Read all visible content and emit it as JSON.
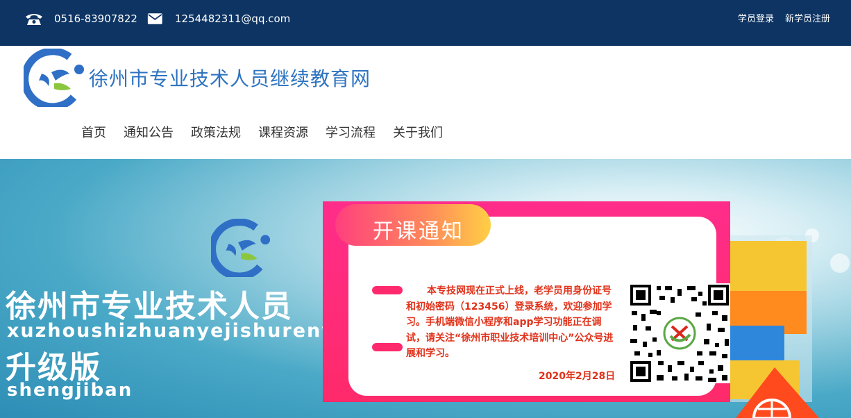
{
  "topbar": {
    "phone_icon": "telephone-icon",
    "phone": "0516-83907822",
    "mail_icon": "envelope-icon",
    "email": "1254482311@qq.com",
    "links": [
      "学员登录",
      "新学员注册"
    ]
  },
  "header": {
    "logo_icon": "site-logo",
    "title": "徐州市专业技术人员继续教育网",
    "nav": [
      "首页",
      "通知公告",
      "政策法规",
      "课程资源",
      "学习流程",
      "关于我们"
    ]
  },
  "banner": {
    "title_cn": "徐州市专业技术人员",
    "title_pinyin": "xuzhoushizhuanyejishurenyuan",
    "subtitle_cn": "升级版",
    "subtitle_pinyin": "shengjiban"
  },
  "popup": {
    "title": "开课通知",
    "notice": "本专技网现在正式上线，老学员用身份证号和初始密码（123456）登录系统，欢迎参加学习。手机端微信小程序和app学习功能正在调试，请关注“徐州市职业技术培训中心”公众号进展和学习。",
    "date": "2020年2月28日",
    "qr_icon": "qr-code"
  },
  "colors": {
    "topbar": "#0d3463",
    "title": "#2e73c0",
    "popup": "#ff2a6e",
    "notice": "#e0321a"
  }
}
